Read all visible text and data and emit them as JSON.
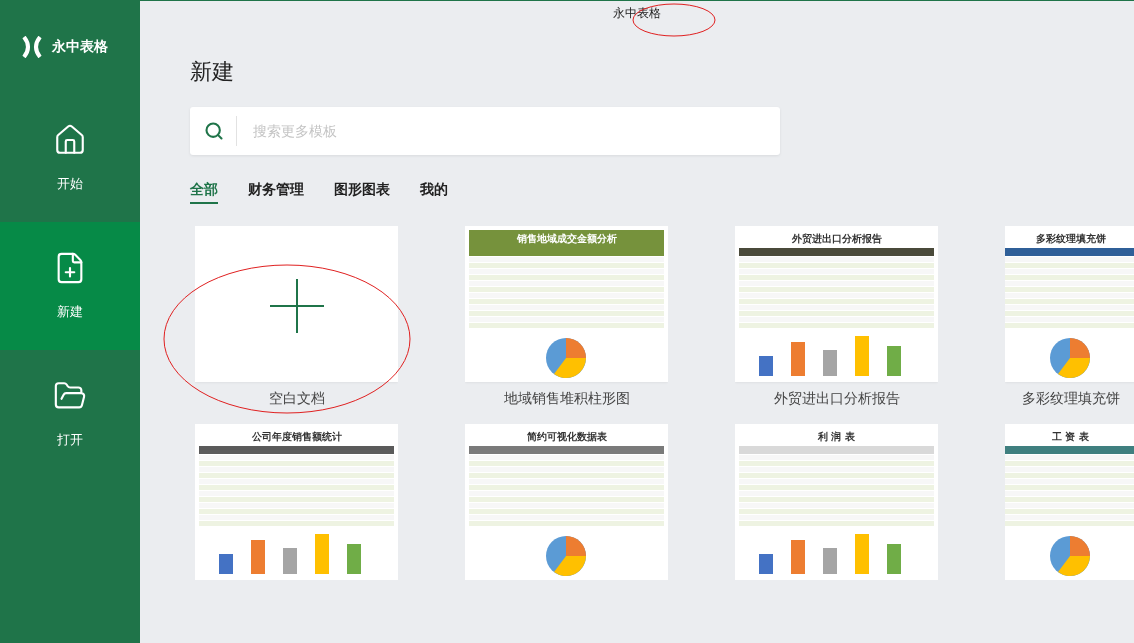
{
  "window": {
    "title": "永中表格"
  },
  "sidebar": {
    "app_name": "永中表格",
    "items": [
      {
        "label": "开始",
        "selected": false
      },
      {
        "label": "新建",
        "selected": true
      },
      {
        "label": "打开",
        "selected": false
      }
    ]
  },
  "page_title": "新建",
  "search": {
    "placeholder": "搜索更多模板"
  },
  "tabs": [
    {
      "label": "全部",
      "selected": true
    },
    {
      "label": "财务管理",
      "selected": false
    },
    {
      "label": "图形图表",
      "selected": false
    },
    {
      "label": "我的",
      "selected": false
    }
  ],
  "templates": [
    {
      "kind": "blank",
      "label": "空白文档"
    },
    {
      "kind": "sheet",
      "label": "地域销售堆积柱形图",
      "title": "销售地域成交金额分析",
      "banner": true,
      "color": "#76923c"
    },
    {
      "kind": "sheet",
      "label": "外贸进出口分析报告",
      "title": "外贸进出口分析报告",
      "banner": false,
      "color": "#4a4a3a"
    },
    {
      "kind": "sheet",
      "label": "多彩纹理填充饼",
      "title": "多彩纹理填充饼",
      "banner": false,
      "color": "#2f5f98"
    },
    {
      "kind": "sheet",
      "title": "公司年度销售额统计",
      "banner": false,
      "color": "#5a5a5a"
    },
    {
      "kind": "sheet",
      "title": "简约可视化数据表",
      "banner": false,
      "color": "#7a7a7a"
    },
    {
      "kind": "sheet",
      "title": "利 润 表",
      "banner": false,
      "color": "#d9d9d9"
    },
    {
      "kind": "sheet",
      "title": "工 资 表",
      "banner": false,
      "color": "#3f7f7f"
    }
  ]
}
